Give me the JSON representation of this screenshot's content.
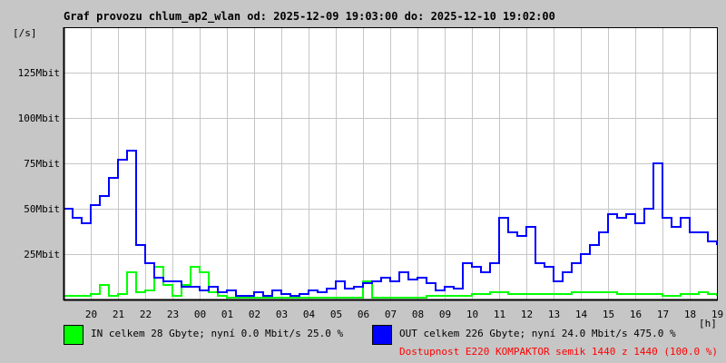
{
  "title": "Graf provozu chlum_ap2_wlan od: 2025-12-09 19:03:00 do: 2025-12-10 19:02:00",
  "chart_data": {
    "type": "line",
    "title": "Graf provozu chlum_ap2_wlan od: 2025-12-09 19:03:00 do: 2025-12-10 19:02:00",
    "ylabel": "[/s]",
    "xlabel": "[h]",
    "ylim": [
      0,
      150
    ],
    "yticks": [
      {
        "value": 25,
        "label": "25Mbit"
      },
      {
        "value": 50,
        "label": "50Mbit"
      },
      {
        "value": 75,
        "label": "75Mbit"
      },
      {
        "value": 100,
        "label": "100Mbit"
      },
      {
        "value": 125,
        "label": "125Mbit"
      }
    ],
    "xticks": [
      "20",
      "21",
      "22",
      "23",
      "00",
      "01",
      "02",
      "03",
      "04",
      "05",
      "06",
      "07",
      "08",
      "09",
      "10",
      "11",
      "12",
      "13",
      "14",
      "15",
      "16",
      "17",
      "18",
      "19"
    ],
    "x_step_minutes": 20,
    "grid": true,
    "series": [
      {
        "name": "IN",
        "color": "#00ff00",
        "unit": "Mbit/s",
        "values": [
          2,
          2,
          2,
          3,
          8,
          2,
          3,
          15,
          4,
          5,
          18,
          8,
          2,
          8,
          18,
          15,
          4,
          2,
          1,
          1,
          1,
          1,
          1,
          1,
          1,
          1,
          1,
          1,
          1,
          1,
          1,
          1,
          1,
          10,
          1,
          1,
          1,
          1,
          1,
          1,
          2,
          2,
          2,
          2,
          2,
          3,
          3,
          4,
          4,
          3,
          3,
          3,
          3,
          3,
          3,
          3,
          4,
          4,
          4,
          4,
          4,
          3,
          3,
          3,
          3,
          3,
          2,
          2,
          3,
          3,
          4,
          3,
          2
        ]
      },
      {
        "name": "OUT",
        "color": "#0000ff",
        "unit": "Mbit/s",
        "values": [
          50,
          45,
          42,
          52,
          57,
          67,
          77,
          82,
          30,
          20,
          12,
          10,
          10,
          7,
          7,
          5,
          7,
          4,
          5,
          2,
          2,
          4,
          2,
          5,
          3,
          2,
          3,
          5,
          4,
          6,
          10,
          6,
          7,
          9,
          10,
          12,
          10,
          15,
          11,
          12,
          9,
          5,
          7,
          6,
          20,
          18,
          15,
          20,
          45,
          37,
          35,
          40,
          20,
          18,
          10,
          15,
          20,
          25,
          30,
          37,
          47,
          45,
          47,
          42,
          50,
          75,
          45,
          40,
          45,
          37,
          37,
          32,
          30
        ]
      }
    ]
  },
  "legend": {
    "in_text": "IN celkem 28 Gbyte; nyní   0.0 Mbit/s 25.0 %",
    "out_text": "OUT celkem 226 Gbyte; nyní  24.0 Mbit/s 475.0 %",
    "availability": "Dostupnost E220 KOMPAKTOR semik 1440 z 1440 (100.0 %)",
    "availability_color": "#ff0000"
  }
}
